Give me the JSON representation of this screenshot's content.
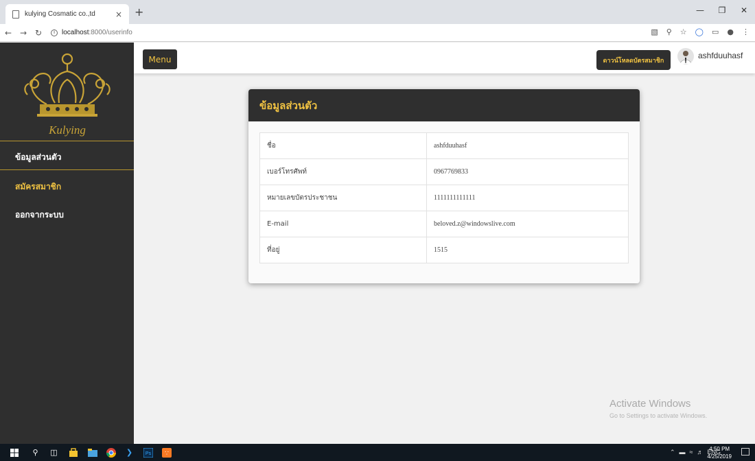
{
  "browser": {
    "tab_title": "kulying Cosmatic co.,td",
    "tab_close": "×",
    "new_tab": "+",
    "url_host": "localhost",
    "url_path": ":8000/userinfo"
  },
  "sidebar": {
    "brand": "Kulying",
    "items": [
      {
        "label": "ข้อมูลส่วนตัว"
      },
      {
        "label": "สมัครสมาชิก"
      },
      {
        "label": "ออกจากระบบ"
      }
    ]
  },
  "topbar": {
    "menu_label": "Menu",
    "download_label": "ดาวน์โหลดบัตรสมาชิก",
    "username": "ashfduuhasf"
  },
  "card": {
    "title": "ข้อมูลส่วนตัว",
    "rows": [
      {
        "label": "ชื่อ",
        "value": "ashfduuhasf"
      },
      {
        "label": "เบอร์โทรศัพท์",
        "value": "0967769833"
      },
      {
        "label": "หมายเลขบัตรประชาชน",
        "value": "1111111111111"
      },
      {
        "label": "E-mail",
        "value": "beloved.z@windowslive.com"
      },
      {
        "label": "ที่อยู่",
        "value": "1515"
      }
    ]
  },
  "watermark": {
    "line1": "Activate Windows",
    "line2": "Go to Settings to activate Windows."
  },
  "taskbar": {
    "lang": "ENG",
    "time": "4:50 PM",
    "date": "4/25/2019"
  },
  "colors": {
    "accent_gold": "#f0c242",
    "dark_panel": "#2f2f2f"
  }
}
